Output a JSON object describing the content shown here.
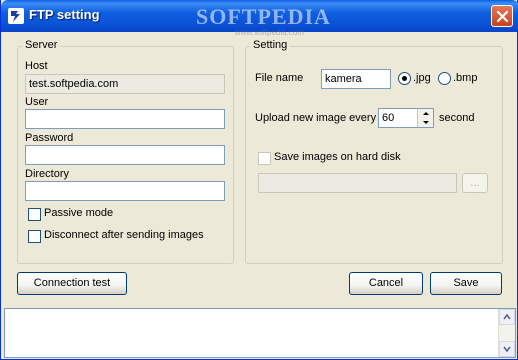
{
  "window": {
    "title": "FTP setting",
    "watermark": "SOFTPEDIA",
    "watermark_sub": "www.softpedia.com"
  },
  "server": {
    "group_label": "Server",
    "host_label": "Host",
    "host_value": "test.softpedia.com",
    "user_label": "User",
    "user_value": "",
    "password_label": "Password",
    "password_value": "",
    "directory_label": "Directory",
    "directory_value": "",
    "passive_label": "Passive mode",
    "disconnect_label": "Disconnect after sending images"
  },
  "setting": {
    "group_label": "Setting",
    "filename_label": "File name",
    "filename_value": "kamera",
    "jpg_label": ".jpg",
    "bmp_label": ".bmp",
    "format_selected": "jpg",
    "upload_label": "Upload new image every",
    "upload_value": "60",
    "upload_unit": "second",
    "save_hd_label": "Save images on hard disk",
    "save_path_value": "",
    "browse_label": "..."
  },
  "buttons": {
    "connection_test": "Connection test",
    "cancel": "Cancel",
    "save": "Save"
  },
  "log": {
    "text": ""
  }
}
